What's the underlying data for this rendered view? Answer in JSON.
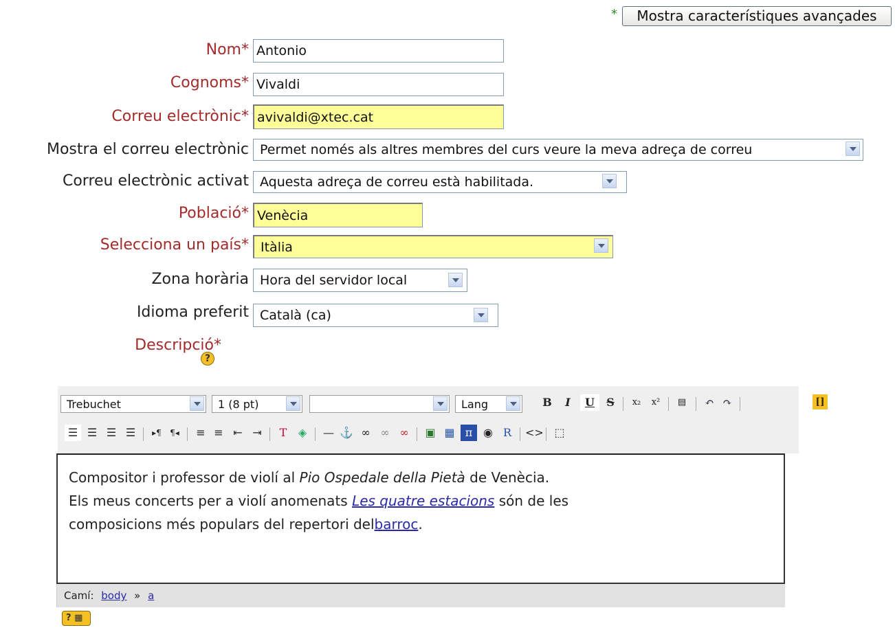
{
  "advanced": {
    "label": "Mostra característiques avançades",
    "required_mark": "*"
  },
  "form": {
    "nom": {
      "label": "Nom*",
      "value": "Antonio"
    },
    "cognoms": {
      "label": "Cognoms*",
      "value": "Vivaldi"
    },
    "email": {
      "label": "Correu electrònic*",
      "value": "avivaldi@xtec.cat"
    },
    "email_display": {
      "label": "Mostra el correu electrònic",
      "value": "Permet només als altres membres del curs veure la meva adreça de correu"
    },
    "email_enabled": {
      "label": "Correu electrònic activat",
      "value": "Aquesta adreça de correu està habilitada."
    },
    "city": {
      "label": "Població*",
      "value": "Venècia"
    },
    "country": {
      "label": "Selecciona un país*",
      "value": "Itàlia"
    },
    "timezone": {
      "label": "Zona horària",
      "value": "Hora del servidor local"
    },
    "language": {
      "label": "Idioma preferit",
      "value": "Català (ca)"
    },
    "description": {
      "label": "Descripció*",
      "help_icon": "question-icon"
    }
  },
  "editor": {
    "font_family": "Trebuchet",
    "font_size": "1 (8 pt)",
    "style": "",
    "lang": "Lang",
    "content": {
      "p1_start": "Compositor i professor de violí al ",
      "p1_italic": "Pio Ospedale della Pietà",
      "p1_end": " de Venècia.",
      "p2_start": "Els meus concerts per a violí anomenats ",
      "p2_link": "Les quatre estacions",
      "p2_end": " són de les",
      "p3_start": "composicions més populars del repertori del",
      "p3_link": "barroc",
      "p3_end": "."
    },
    "path": {
      "label": "Camí:",
      "crumb1": "body",
      "sep": "»",
      "crumb2": "a"
    }
  },
  "icons": [
    "bold-icon",
    "italic-icon",
    "underline-icon",
    "strikethrough-icon",
    "subscript-icon",
    "superscript-icon",
    "undo-icon",
    "redo-icon",
    "align-left-icon",
    "align-center-icon",
    "align-right-icon",
    "justify-icon",
    "ordered-list-icon",
    "unordered-list-icon",
    "outdent-icon",
    "indent-icon",
    "text-color-icon",
    "bg-color-icon",
    "horizontal-rule-icon",
    "anchor-icon",
    "link-icon",
    "unlink-icon",
    "image-icon",
    "table-icon",
    "math-icon",
    "html-source-icon",
    "fullscreen-icon",
    "keyboard-help-icon"
  ]
}
